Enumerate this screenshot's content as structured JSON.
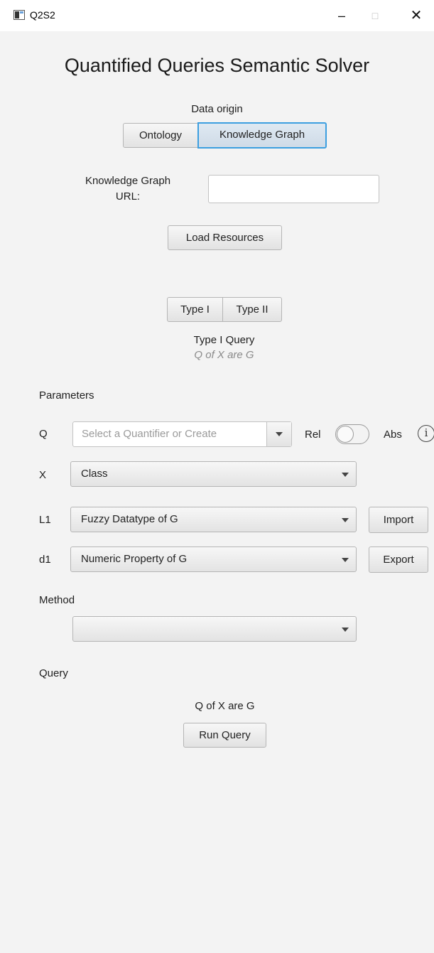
{
  "window": {
    "title": "Q2S2",
    "icon": "app-window-icon",
    "controls": {
      "minimize": "–",
      "maximize": "□",
      "close": "✕"
    }
  },
  "app_title": "Quantified Queries Semantic Solver",
  "data_origin": {
    "label": "Data origin",
    "options": [
      "Ontology",
      "Knowledge Graph"
    ],
    "selected": "Knowledge Graph"
  },
  "kg_url": {
    "label_line1": "Knowledge Graph",
    "label_line2": "URL:",
    "value": ""
  },
  "load_button": "Load Resources",
  "query_type": {
    "options": [
      "Type I",
      "Type II"
    ],
    "title": "Type I Query",
    "formula": "Q of X are G"
  },
  "parameters": {
    "heading": "Parameters",
    "q": {
      "label": "Q",
      "placeholder": "Select a Quantifier or Create",
      "toggle_left": "Rel",
      "toggle_right": "Abs",
      "info": "i"
    },
    "x": {
      "label": "X",
      "value": "Class"
    },
    "l1": {
      "label": "L1",
      "value": "Fuzzy Datatype of G",
      "button": "Import"
    },
    "d1": {
      "label": "d1",
      "value": "Numeric Property of G",
      "button": "Export"
    }
  },
  "method": {
    "heading": "Method",
    "value": ""
  },
  "query": {
    "heading": "Query",
    "text": "Q of X are G",
    "run_button": "Run Query"
  },
  "colors": {
    "background": "#f3f3f3",
    "selected_border": "#3c9fe0",
    "placeholder_text": "#9a9a9a"
  }
}
